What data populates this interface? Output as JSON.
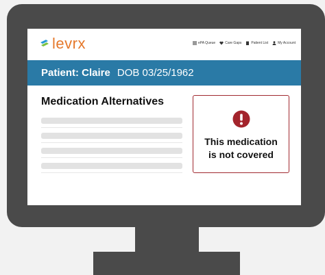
{
  "app": {
    "logo_text": "levrx"
  },
  "nav": {
    "items": [
      {
        "label": "ePA Queue",
        "icon": "list-icon"
      },
      {
        "label": "Care Gaps",
        "icon": "heart-icon"
      },
      {
        "label": "Patient List",
        "icon": "clipboard-icon"
      },
      {
        "label": "My Account",
        "icon": "user-icon"
      }
    ]
  },
  "patient": {
    "label": "Patient: Claire",
    "dob": "DOB 03/25/1962"
  },
  "main": {
    "title": "Medication Alternatives"
  },
  "alert": {
    "line1": "This medication",
    "line2": "is not covered",
    "icon": "exclamation-circle-icon"
  },
  "colors": {
    "banner": "#2a7aa6",
    "logo": "#e5782b",
    "alert_border": "#a0282e",
    "alert_icon": "#a3242c",
    "monitor": "#4a4a4a"
  }
}
